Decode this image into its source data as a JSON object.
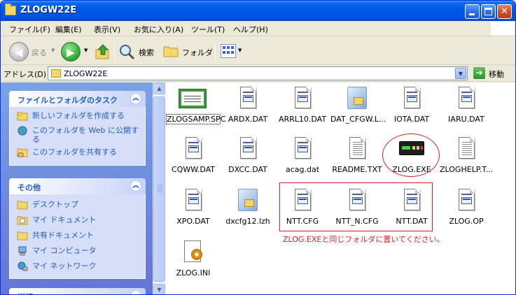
{
  "window": {
    "title": "ZLOGW22E"
  },
  "menu": [
    {
      "label": "ファイル(F)"
    },
    {
      "label": "編集(E)"
    },
    {
      "label": "表示(V)"
    },
    {
      "label": "お気に入り(A)"
    },
    {
      "label": "ツール(T)"
    },
    {
      "label": "ヘルプ(H)"
    }
  ],
  "toolbar": {
    "back_label": "戻る",
    "search_label": "検索",
    "folders_label": "フォルダ"
  },
  "address": {
    "label": "アドレス(D)",
    "value": "ZLOGW22E",
    "go_label": "移動"
  },
  "taskpane": {
    "file_tasks": {
      "title": "ファイルとフォルダのタスク",
      "items": [
        {
          "label": "新しいフォルダを作成する"
        },
        {
          "label": "このフォルダを Web に公開する"
        },
        {
          "label": "このフォルダを共有する"
        }
      ]
    },
    "other_places": {
      "title": "その他",
      "items": [
        {
          "label": "デスクトップ"
        },
        {
          "label": "マイ ドキュメント"
        },
        {
          "label": "共有ドキュメント"
        },
        {
          "label": "マイ コンピュータ"
        },
        {
          "label": "マイ ネットワーク"
        }
      ]
    },
    "details": {
      "title": "詳細"
    }
  },
  "files": [
    {
      "name": "ZLOGSAMP.SPC",
      "icon": "sample-file-icon"
    },
    {
      "name": "ARDX.DAT",
      "icon": "dat-file-icon"
    },
    {
      "name": "ARRL10.DAT",
      "icon": "dat-file-icon"
    },
    {
      "name": "DAT_CFGW.L...",
      "icon": "archive-icon"
    },
    {
      "name": "IOTA.DAT",
      "icon": "dat-file-icon"
    },
    {
      "name": "IARU.DAT",
      "icon": "dat-file-icon"
    },
    {
      "name": "CQWW.DAT",
      "icon": "dat-file-icon"
    },
    {
      "name": "DXCC.DAT",
      "icon": "dat-file-icon"
    },
    {
      "name": "acag.dat",
      "icon": "dat-file-icon"
    },
    {
      "name": "README.TXT",
      "icon": "text-file-icon"
    },
    {
      "name": "ZLOG.EXE",
      "icon": "radio-exe-icon"
    },
    {
      "name": "ZLOGHELP.T...",
      "icon": "text-file-icon"
    },
    {
      "name": "XPO.DAT",
      "icon": "dat-file-icon"
    },
    {
      "name": "dxcfg12.lzh",
      "icon": "archive-icon"
    },
    {
      "name": "NTT.CFG",
      "icon": "dat-file-icon"
    },
    {
      "name": "NTT_N.CFG",
      "icon": "dat-file-icon"
    },
    {
      "name": "NTT.DAT",
      "icon": "dat-file-icon"
    },
    {
      "name": "ZLOG.OP",
      "icon": "dat-file-icon"
    },
    {
      "name": "ZLOG.INI",
      "icon": "ini-file-icon"
    }
  ],
  "annotation": {
    "text": "ZLOG.EXEと同じフォルダに置いてください。",
    "color": "#E02020"
  },
  "colors": {
    "titlebar": "#0054E3",
    "taskpane_link": "#215DC6"
  }
}
